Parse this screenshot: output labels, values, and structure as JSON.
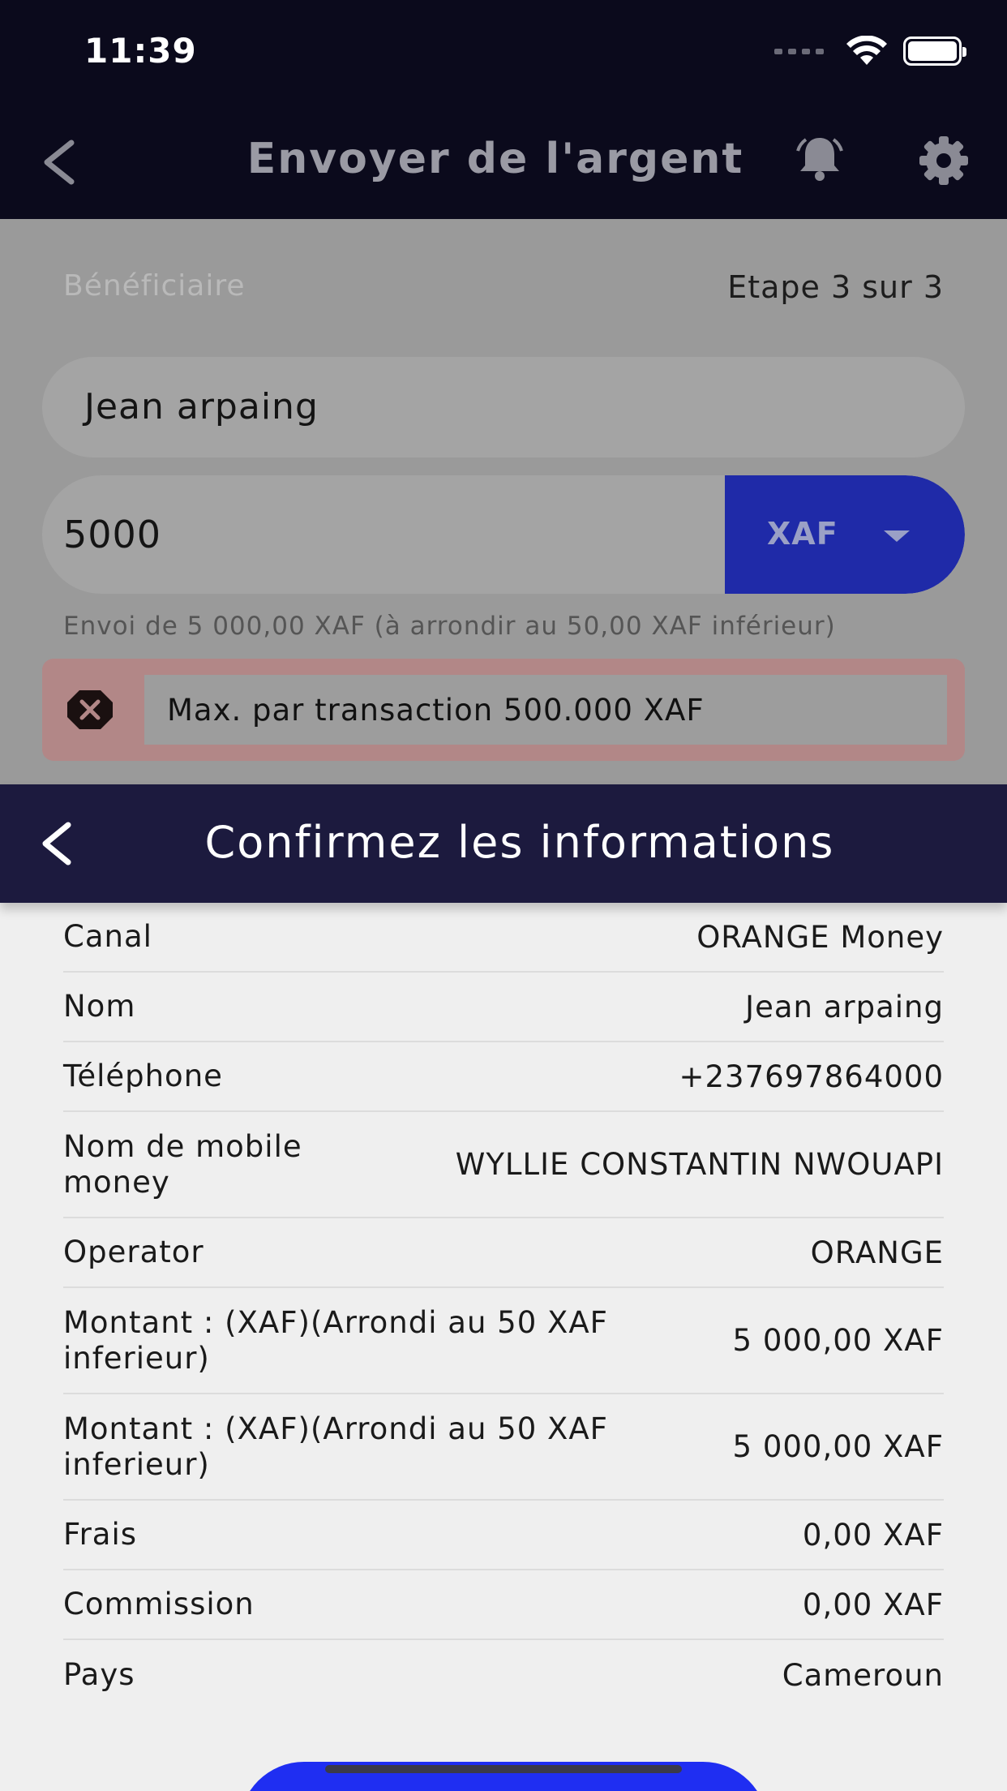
{
  "status_bar": {
    "time": "11:39"
  },
  "header": {
    "title": "Envoyer de l'argent"
  },
  "form": {
    "beneficiary_label": "Bénéficiaire",
    "step_label": "Etape 3 sur 3",
    "name_value": "Jean arpaing",
    "amount_value": "5000",
    "currency": "XAF",
    "envoi_text": "Envoi de  5 000,00 XAF  (à arrondir au 50,00 XAF inférieur)",
    "error_text": "Max. par transaction 500.000 XAF"
  },
  "modal": {
    "title": "Confirmez les informations",
    "rows": [
      {
        "label": "Canal",
        "value": "ORANGE Money"
      },
      {
        "label": "Nom",
        "value": "Jean arpaing"
      },
      {
        "label": "Téléphone",
        "value": "+237697864000"
      },
      {
        "label": "Nom de mobile money",
        "value": "WYLLIE  CONSTANTIN NWOUAPI"
      },
      {
        "label": "Operator",
        "value": "ORANGE"
      },
      {
        "label": "Montant : (XAF)(Arrondi au 50 XAF inferieur)",
        "value": "5 000,00 XAF"
      },
      {
        "label": "Montant : (XAF)(Arrondi au 50 XAF inferieur)",
        "value": "5 000,00 XAF"
      },
      {
        "label": "Frais",
        "value": "0,00 XAF"
      },
      {
        "label": "Commission",
        "value": "0,00 XAF"
      },
      {
        "label": "Pays",
        "value": "Cameroun"
      }
    ]
  },
  "colors": {
    "header_bg": "#0b0a1c",
    "modal_header_bg": "#1c1a3e",
    "accent_blue": "#1f2ef2",
    "error_bg": "#b28787"
  }
}
